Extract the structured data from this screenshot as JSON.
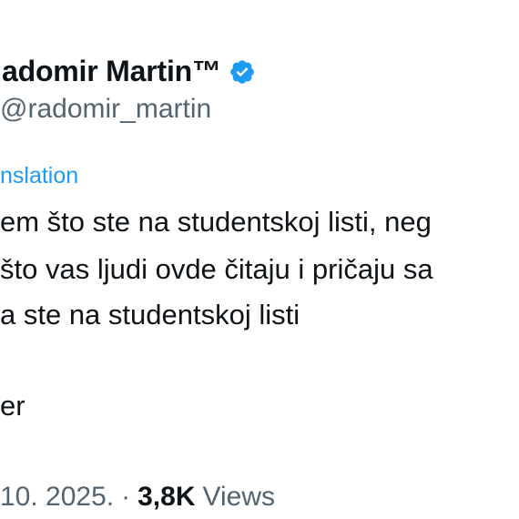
{
  "author": {
    "display_name": "adomir Martin™",
    "handle": "radomir_martin"
  },
  "translation_label": "nslation",
  "tweet_lines": [
    "em što ste na studentskoj listi, neg",
    "što vas ljudi ovde čitaju i pričaju sa",
    "a ste na studentskoj listi",
    "er"
  ],
  "meta": {
    "date": "10. 2025.",
    "separator": "·",
    "views_count": "3,8K",
    "views_label": "Views"
  },
  "colors": {
    "verified_badge": "#1d9bf0",
    "link": "#1d9bf0",
    "secondary_text": "#536471"
  },
  "icons": {
    "verified": "verified-badge-icon"
  }
}
